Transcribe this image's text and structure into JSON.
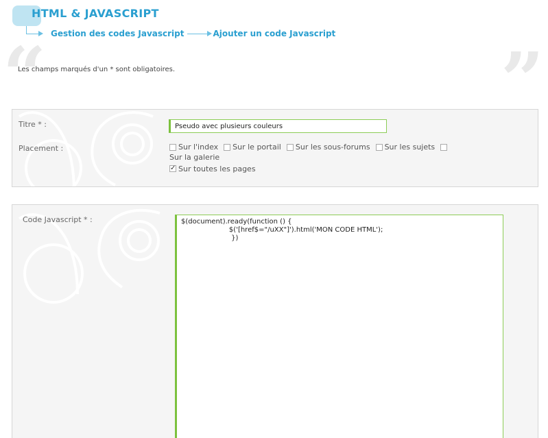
{
  "header": {
    "title": "HTML & JAVASCRIPT",
    "breadcrumb": [
      "Gestion des codes Javascript",
      "Ajouter un code Javascript"
    ]
  },
  "note": "Les champs marqués d'un * sont obligatoires.",
  "form1": {
    "title_label": "Titre * :",
    "title_value": "Pseudo avec plusieurs couleurs",
    "placement_label": "Placement :",
    "options": [
      {
        "label": "Sur l'index",
        "checked": false
      },
      {
        "label": "Sur le portail",
        "checked": false
      },
      {
        "label": "Sur les sous-forums",
        "checked": false
      },
      {
        "label": "Sur les sujets",
        "checked": false
      },
      {
        "label": "Sur la galerie",
        "checked": false
      }
    ],
    "all_pages": {
      "label": "Sur toutes les pages",
      "checked": true
    }
  },
  "form2": {
    "code_label": "Code Javascript * :",
    "code_lines": [
      "$(document).ready(function () {",
      "                      $('[href$=\"/uXX\"]').html('MON CODE HTML');",
      "                       })"
    ]
  },
  "colors": {
    "accent": "#2a9fd0",
    "accent_light": "#bfe4f2",
    "input_border": "#7cc13e",
    "panel_bg": "#f5f5f5"
  }
}
